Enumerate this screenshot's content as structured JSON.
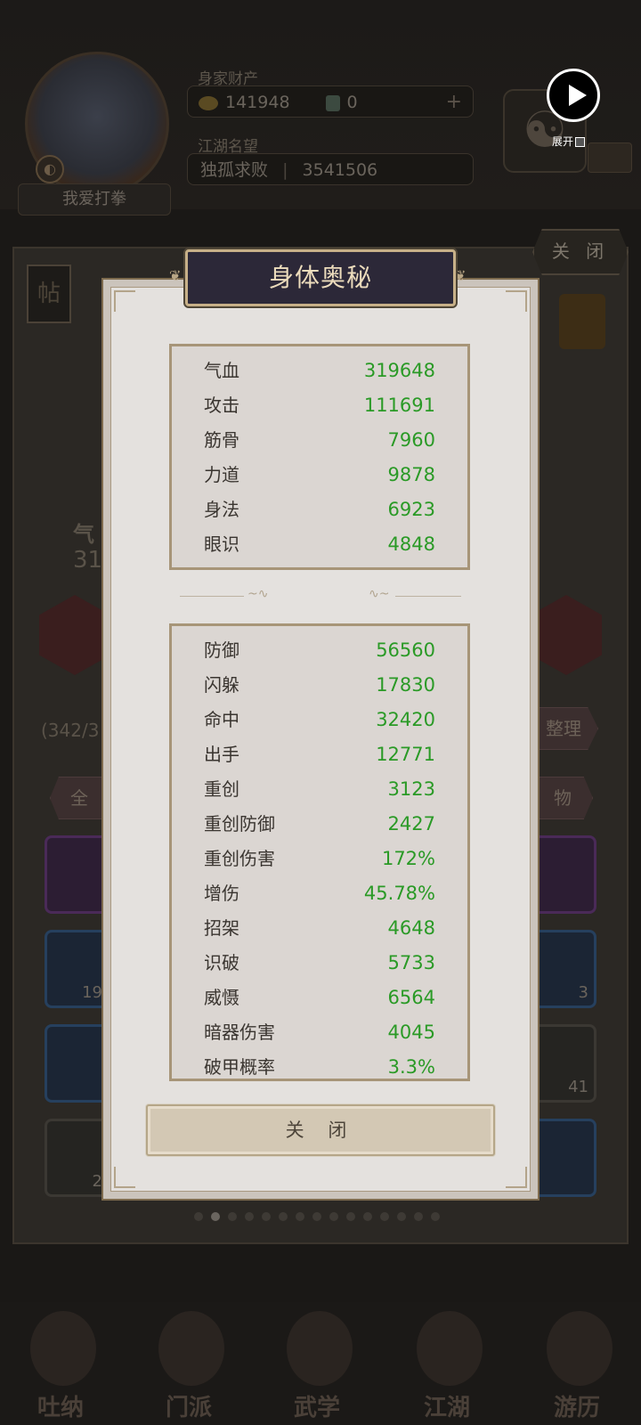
{
  "background": {
    "player_name": "我爱打拳",
    "wealth_label": "身家财产",
    "coins": "141948",
    "tickets": "0",
    "fame_label": "江湖名望",
    "fame_title": "独孤求败",
    "fame_value": "3541506",
    "close_label": "关 闭",
    "tie_label": "帖",
    "bag_count": "(342/3",
    "partial_hp_label": "气",
    "partial_hp_value": "31",
    "tab_all": "全",
    "tab_items": "物",
    "sort_label": "整理",
    "cell_counts": [
      "19",
      "3",
      "41",
      "2"
    ],
    "nav": [
      "吐纳",
      "门派",
      "武学",
      "江湖",
      "游历"
    ]
  },
  "overlay": {
    "expand_label": "展开"
  },
  "modal": {
    "title": "身体奥秘",
    "primary_stats": [
      {
        "name": "气血",
        "value": "319648"
      },
      {
        "name": "攻击",
        "value": "111691"
      },
      {
        "name": "筋骨",
        "value": "7960"
      },
      {
        "name": "力道",
        "value": "9878"
      },
      {
        "name": "身法",
        "value": "6923"
      },
      {
        "name": "眼识",
        "value": "4848"
      }
    ],
    "secondary_stats": [
      {
        "name": "防御",
        "value": "56560"
      },
      {
        "name": "闪躲",
        "value": "17830"
      },
      {
        "name": "命中",
        "value": "32420"
      },
      {
        "name": "出手",
        "value": "12771"
      },
      {
        "name": "重创",
        "value": "3123"
      },
      {
        "name": "重创防御",
        "value": "2427"
      },
      {
        "name": "重创伤害",
        "value": "172%"
      },
      {
        "name": "增伤",
        "value": "45.78%"
      },
      {
        "name": "招架",
        "value": "4648"
      },
      {
        "name": "识破",
        "value": "5733"
      },
      {
        "name": "威慑",
        "value": "6564"
      },
      {
        "name": "暗器伤害",
        "value": "4045"
      },
      {
        "name": "破甲概率",
        "value": "3.3%"
      }
    ],
    "close_button": "关 闭"
  },
  "pager": {
    "total": 15,
    "active": 1
  },
  "colors": {
    "stat_value": "#2a9a26",
    "title_bg": "#2c2838",
    "title_text": "#ecdcbc"
  }
}
